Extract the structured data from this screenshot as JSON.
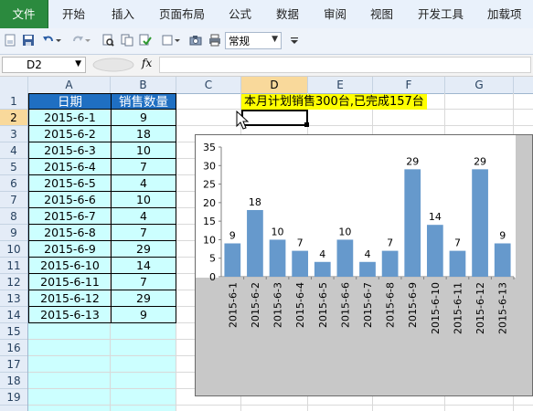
{
  "ribbon": {
    "tabs": [
      "文件",
      "开始",
      "插入",
      "页面布局",
      "公式",
      "数据",
      "审阅",
      "视图",
      "开发工具",
      "加载项"
    ]
  },
  "toolbar": {
    "number_format": "常规",
    "icons": [
      "new-icon",
      "save-icon",
      "undo-icon",
      "redo-icon",
      "print-preview-icon",
      "copy-icon",
      "spellcheck-icon",
      "checkbox-icon",
      "camera-icon",
      "print-icon"
    ]
  },
  "formula_bar": {
    "name_box": "D2",
    "fx_label": "fx",
    "formula": ""
  },
  "grid": {
    "columns": [
      "A",
      "B",
      "C",
      "D",
      "E",
      "F",
      "G"
    ],
    "rows": [
      "1",
      "2",
      "3",
      "4",
      "5",
      "6",
      "7",
      "8",
      "9",
      "10",
      "11",
      "12",
      "13",
      "14",
      "15",
      "16",
      "17",
      "18",
      "19"
    ],
    "selected_cell": "D2",
    "header": {
      "date": "日期",
      "qty": "销售数量"
    },
    "data": [
      {
        "date": "2015-6-1",
        "qty": "9"
      },
      {
        "date": "2015-6-2",
        "qty": "18"
      },
      {
        "date": "2015-6-3",
        "qty": "10"
      },
      {
        "date": "2015-6-4",
        "qty": "7"
      },
      {
        "date": "2015-6-5",
        "qty": "4"
      },
      {
        "date": "2015-6-6",
        "qty": "10"
      },
      {
        "date": "2015-6-7",
        "qty": "4"
      },
      {
        "date": "2015-6-8",
        "qty": "7"
      },
      {
        "date": "2015-6-9",
        "qty": "29"
      },
      {
        "date": "2015-6-10",
        "qty": "14"
      },
      {
        "date": "2015-6-11",
        "qty": "7"
      },
      {
        "date": "2015-6-12",
        "qty": "29"
      },
      {
        "date": "2015-6-13",
        "qty": "9"
      }
    ],
    "note": "本月计划销售300台,已完成157台"
  },
  "colors": {
    "file_tab": "#2b8a3e",
    "header_fill": "#1f6fc2",
    "data_fill": "#ccffff",
    "note_fill": "#ffff00",
    "bar": "#6699cc",
    "chart_bg": "#c8c8c8"
  },
  "chart_data": {
    "type": "bar",
    "categories": [
      "2015-6-1",
      "2015-6-2",
      "2015-6-3",
      "2015-6-4",
      "2015-6-5",
      "2015-6-6",
      "2015-6-7",
      "2015-6-8",
      "2015-6-9",
      "2015-6-10",
      "2015-6-11",
      "2015-6-12",
      "2015-6-13"
    ],
    "series": [
      {
        "values": [
          9,
          18,
          10,
          7,
          4,
          10,
          4,
          7,
          29,
          14,
          7,
          29,
          9
        ]
      }
    ],
    "ylim": [
      0,
      35
    ],
    "yticks": [
      0,
      5,
      10,
      15,
      20,
      25,
      30,
      35
    ],
    "xtick_rotation": "vertical",
    "data_labels": true,
    "grid": false,
    "legend": "none"
  }
}
